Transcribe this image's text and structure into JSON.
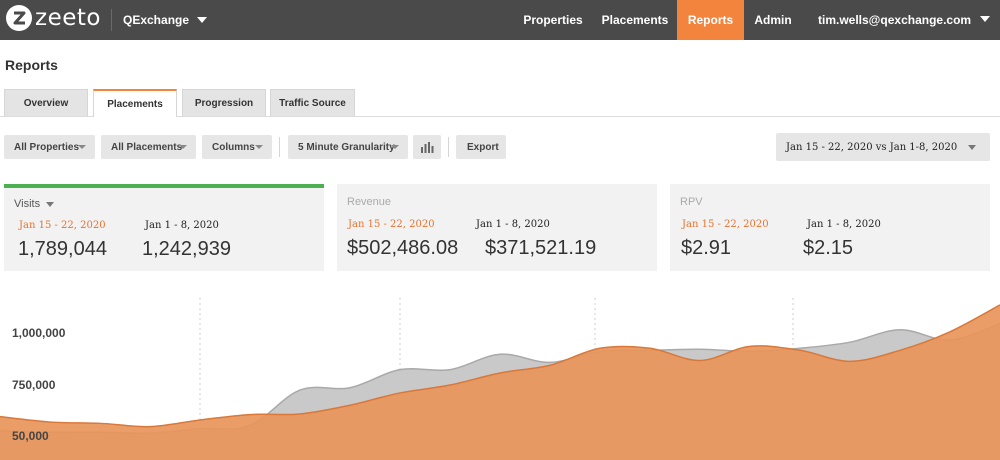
{
  "header": {
    "brand": "zeeto",
    "account": "QExchange",
    "nav": [
      {
        "label": "Properties",
        "active": false
      },
      {
        "label": "Placements",
        "active": false
      },
      {
        "label": "Reports",
        "active": true
      },
      {
        "label": "Admin",
        "active": false
      }
    ],
    "user_email": "tim.wells@qexchange.com",
    "icons": {
      "logo": "zeeto-logo-icon",
      "account_caret": "chevron-down-icon",
      "user_caret": "chevron-down-icon"
    }
  },
  "page": {
    "title": "Reports",
    "tabs": [
      {
        "label": "Overview",
        "active": false
      },
      {
        "label": "Placements",
        "active": true
      },
      {
        "label": "Progression",
        "active": false
      },
      {
        "label": "Traffic Source",
        "active": false
      }
    ]
  },
  "toolbar": {
    "properties_filter": "All Properties",
    "placements_filter": "All Placements",
    "columns": "Columns",
    "granularity": "5 Minute Granularity",
    "chart_icon": "bar-chart-icon",
    "export": "Export",
    "date_range": "Jan 15 - 22, 2020 vs Jan 1-8, 2020"
  },
  "metrics": [
    {
      "label": "Visits",
      "selected": true,
      "current_period": "Jan 15 - 22, 2020",
      "previous_period": "Jan 1 - 8, 2020",
      "current_value": "1,789,044",
      "previous_value": "1,242,939"
    },
    {
      "label": "Revenue",
      "selected": false,
      "current_period": "Jan 15 - 22, 2020",
      "previous_period": "Jan 1 - 8, 2020",
      "current_value": "$502,486.08",
      "previous_value": "$371,521.19"
    },
    {
      "label": "RPV",
      "selected": false,
      "current_period": "Jan 15 - 22, 2020",
      "previous_period": "Jan 1 - 8, 2020",
      "current_value": "$2.91",
      "previous_value": "$2.15"
    }
  ],
  "colors": {
    "accent": "#f2843d",
    "selected_card": "#4caf50",
    "current_series": "#e8955a",
    "previous_series": "#c9c9c9"
  },
  "chart_data": {
    "type": "area",
    "y_tick_labels": [
      "1,000,000",
      "750,000",
      "50,000"
    ],
    "grid": "vertical dotted",
    "series": [
      {
        "period": "current",
        "points": [
          [
            0,
            593
          ],
          [
            0.05,
            567
          ],
          [
            0.1,
            561
          ],
          [
            0.15,
            545
          ],
          [
            0.2,
            577
          ],
          [
            0.25,
            603
          ],
          [
            0.3,
            606
          ],
          [
            0.35,
            648
          ],
          [
            0.4,
            707
          ],
          [
            0.45,
            745
          ],
          [
            0.5,
            803
          ],
          [
            0.55,
            840
          ],
          [
            0.6,
            922
          ],
          [
            0.65,
            922
          ],
          [
            0.7,
            863
          ],
          [
            0.75,
            931
          ],
          [
            0.8,
            912
          ],
          [
            0.85,
            859
          ],
          [
            0.9,
            912
          ],
          [
            0.95,
            1001
          ],
          [
            1,
            1130
          ]
        ]
      },
      {
        "period": "previous",
        "points": [
          [
            0,
            524
          ],
          [
            0.05,
            518
          ],
          [
            0.1,
            518
          ],
          [
            0.15,
            514
          ],
          [
            0.2,
            535
          ],
          [
            0.25,
            551
          ],
          [
            0.3,
            721
          ],
          [
            0.35,
            732
          ],
          [
            0.4,
            819
          ],
          [
            0.45,
            819
          ],
          [
            0.5,
            893
          ],
          [
            0.55,
            854
          ],
          [
            0.6,
            907
          ],
          [
            0.65,
            912
          ],
          [
            0.7,
            917
          ],
          [
            0.75,
            907
          ],
          [
            0.8,
            922
          ],
          [
            0.85,
            951
          ],
          [
            0.9,
            1011
          ],
          [
            0.95,
            961
          ],
          [
            1,
            1040
          ]
        ]
      }
    ]
  }
}
